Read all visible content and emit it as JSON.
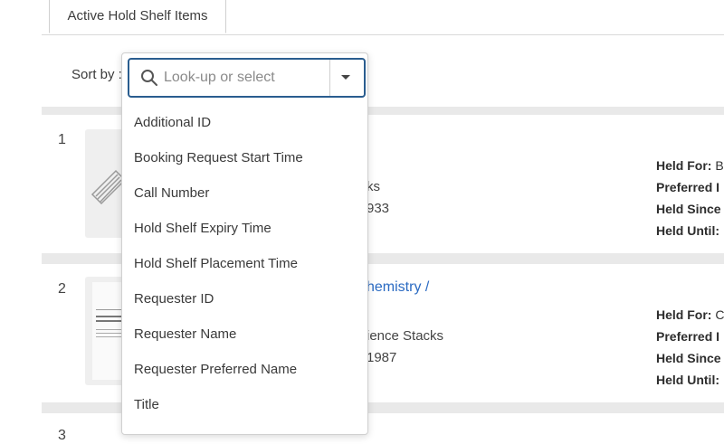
{
  "tabs": [
    {
      "label": "Active Hold Shelf Items"
    }
  ],
  "sort": {
    "label": "Sort by :"
  },
  "lookup": {
    "placeholder": "Look-up or select",
    "value": ""
  },
  "dropdown_options": [
    "Additional ID",
    "Booking Request Start Time",
    "Call Number",
    "Hold Shelf Expiry Time",
    "Hold Shelf Placement Time",
    "Requester ID",
    "Requester Name",
    "Requester Preferred Name",
    "Title"
  ],
  "results": [
    {
      "number": "1",
      "fragments": [
        "ks",
        "933"
      ],
      "held_for_label": "Held For:",
      "held_for_value": "B",
      "preferred_label": "Preferred I",
      "held_since_label": "Held Since",
      "held_until_label": "Held Until:"
    },
    {
      "number": "2",
      "title_fragment": "hemistry /",
      "fragments": [
        "ience Stacks",
        "1987"
      ],
      "held_for_label": "Held For:",
      "held_for_value": "C",
      "preferred_label": "Preferred I",
      "held_since_label": "Held Since",
      "held_until_label": "Held Until:"
    },
    {
      "number": "3"
    }
  ],
  "colors": {
    "accent": "#2a5d8f",
    "link": "#2a6ac2",
    "results_bg": "#e9e9e9"
  }
}
